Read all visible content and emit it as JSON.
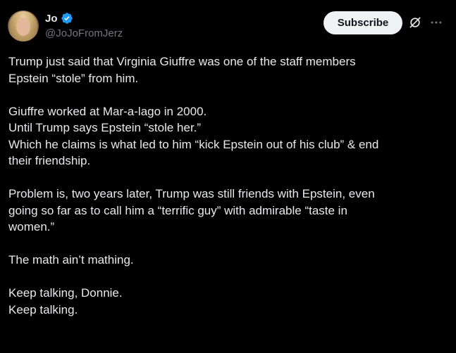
{
  "author": {
    "display_name": "Jo",
    "handle": "@JoJoFromJerz",
    "avatar_icon": "avatar-photo",
    "verified_icon": "verified-badge-icon",
    "verified_color": "#1d9bf0"
  },
  "actions": {
    "subscribe_label": "Subscribe",
    "grok_icon": "grok-slash-icon",
    "more_icon": "more-dots-icon"
  },
  "post": {
    "paragraphs": [
      {
        "lines": [
          "Trump just said that Virginia Giuffre was one of the staff members",
          "Epstein “stole” from him."
        ]
      },
      {
        "lines": [
          "Giuffre worked at Mar-a-lago in 2000.",
          "Until Trump says Epstein “stole her.”",
          "Which he claims is what led to him “kick Epstein out of his club” & end",
          "their friendship."
        ]
      },
      {
        "lines": [
          "Problem is, two years later, Trump was still friends with Epstein, even",
          "going so far as to call him a “terrific guy” with admirable “taste in",
          "women.”"
        ]
      },
      {
        "lines": [
          "The math ain’t mathing."
        ]
      },
      {
        "lines": [
          "Keep talking, Donnie.",
          "Keep talking."
        ]
      }
    ]
  },
  "colors": {
    "background": "#000000",
    "text_primary": "#e7e9ea",
    "text_secondary": "#71767b",
    "button_bg": "#eff3f4",
    "button_text": "#0f1419"
  }
}
